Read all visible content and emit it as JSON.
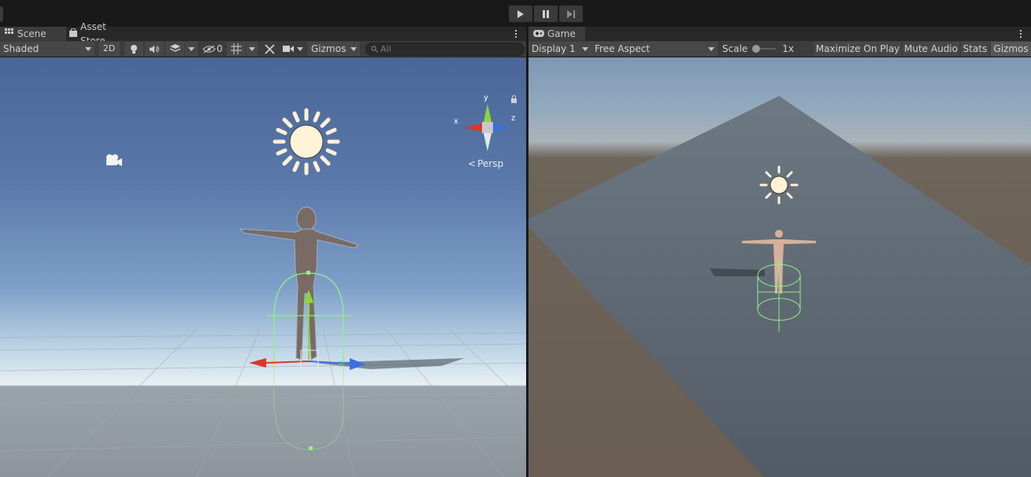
{
  "toolbar_top": {
    "play_icons": [
      "play-icon",
      "pause-icon",
      "step-icon"
    ]
  },
  "scene_panel": {
    "tabs": [
      {
        "label": "Scene",
        "icon": "grid-icon",
        "active": true
      },
      {
        "label": "Asset Store",
        "icon": "bag-icon",
        "active": false
      }
    ],
    "toolbar": {
      "shading_mode": "Shaded",
      "mode_2d": "2D",
      "hidden_count": "0",
      "gizmos_label": "Gizmos",
      "search_placeholder": "All"
    },
    "orientation_gizmo": {
      "x": "x",
      "y": "y",
      "z": "z",
      "projection": "Persp"
    }
  },
  "game_panel": {
    "tabs": [
      {
        "label": "Game",
        "icon": "gamepad-icon",
        "active": true
      }
    ],
    "toolbar": {
      "display": "Display 1",
      "aspect": "Free Aspect",
      "scale_label": "Scale",
      "scale_value": "1x",
      "maximize": "Maximize On Play",
      "mute": "Mute Audio",
      "stats": "Stats",
      "gizmos": "Gizmos"
    }
  },
  "colors": {
    "editor_bg": "#191919",
    "toolbar_bg": "#3c3c3c",
    "button_bg": "#474747",
    "axis_x": "#d8372a",
    "axis_y": "#8cd63a",
    "axis_z": "#3a6fe0",
    "sun": "#fff2d6",
    "collider": "#8ef08a"
  }
}
